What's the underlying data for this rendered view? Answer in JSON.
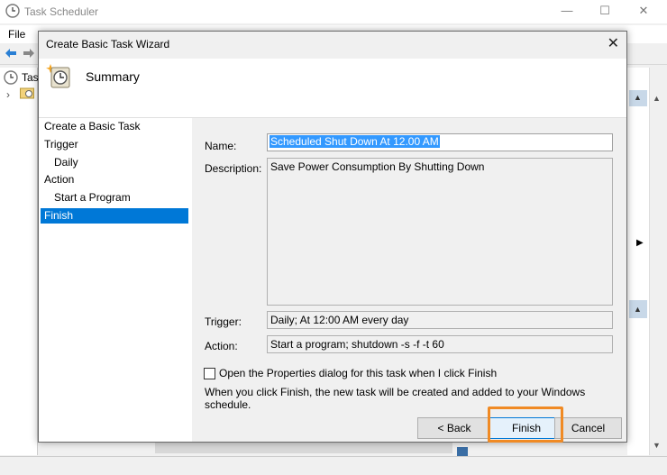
{
  "main_window": {
    "title": "Task Scheduler",
    "menu_file": "File",
    "tree_label": "Task",
    "controls": {
      "minimize": "—",
      "maximize": "☐",
      "close": "✕"
    }
  },
  "dialog": {
    "title": "Create Basic Task Wizard",
    "close_glyph": "✕",
    "header_title": "Summary",
    "steps": [
      {
        "label": "Create a Basic Task"
      },
      {
        "label": "Trigger"
      },
      {
        "label": "Daily"
      },
      {
        "label": "Action"
      },
      {
        "label": "Start a Program"
      },
      {
        "label": "Finish"
      }
    ],
    "selected_step": "Finish",
    "labels": {
      "name": "Name:",
      "description": "Description:",
      "trigger": "Trigger:",
      "action": "Action:"
    },
    "values": {
      "name": "Scheduled Shut Down At 12.00 AM",
      "description": "Save Power Consumption By Shutting Down",
      "trigger": "Daily; At 12:00 AM every day",
      "action": "Start a program; shutdown -s -f -t 60"
    },
    "open_properties_label": "Open the Properties dialog for this task when I click Finish",
    "open_properties_checked": false,
    "info_text": "When you click Finish, the new task will be created and added to your Windows schedule.",
    "buttons": {
      "back": "< Back",
      "finish": "Finish",
      "cancel": "Cancel"
    }
  },
  "colors": {
    "selection": "#0078d7",
    "highlight_box": "#f08a24",
    "name_select": "#3399ff"
  },
  "icons": {
    "app": "clock-icon",
    "wizard": "task-wizard-icon"
  }
}
